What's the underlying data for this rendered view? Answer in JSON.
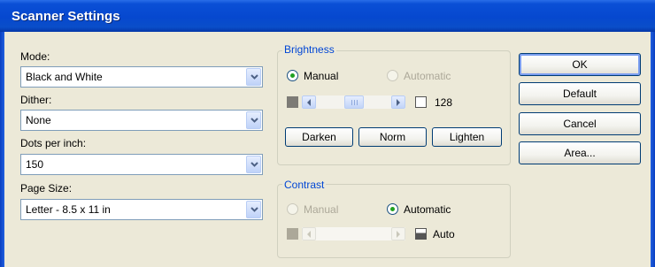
{
  "window": {
    "title": "Scanner Settings"
  },
  "left": {
    "mode": {
      "label": "Mode:",
      "value": "Black and White"
    },
    "dither": {
      "label": "Dither:",
      "value": "None"
    },
    "dpi": {
      "label": "Dots per inch:",
      "value": "150"
    },
    "page_size": {
      "label": "Page Size:",
      "value": "Letter - 8.5 x 11 in"
    }
  },
  "brightness": {
    "legend": "Brightness",
    "manual_label": "Manual",
    "automatic_label": "Automatic",
    "selected": "Manual",
    "value": "128",
    "slider_fraction": 0.5,
    "darken_label": "Darken",
    "norm_label": "Norm",
    "lighten_label": "Lighten"
  },
  "contrast": {
    "legend": "Contrast",
    "manual_label": "Manual",
    "automatic_label": "Automatic",
    "selected": "Automatic",
    "value": "Auto"
  },
  "buttons": {
    "ok": "OK",
    "default": "Default",
    "cancel": "Cancel",
    "area": "Area..."
  },
  "colors": {
    "titlebar": "#0648cf",
    "dialog_bg": "#ece9d8",
    "group_legend": "#0046d5",
    "radio_dot": "#21a121"
  },
  "icons": [
    "chevron-down-icon",
    "arrow-left-icon",
    "arrow-right-icon",
    "grip-icon"
  ]
}
